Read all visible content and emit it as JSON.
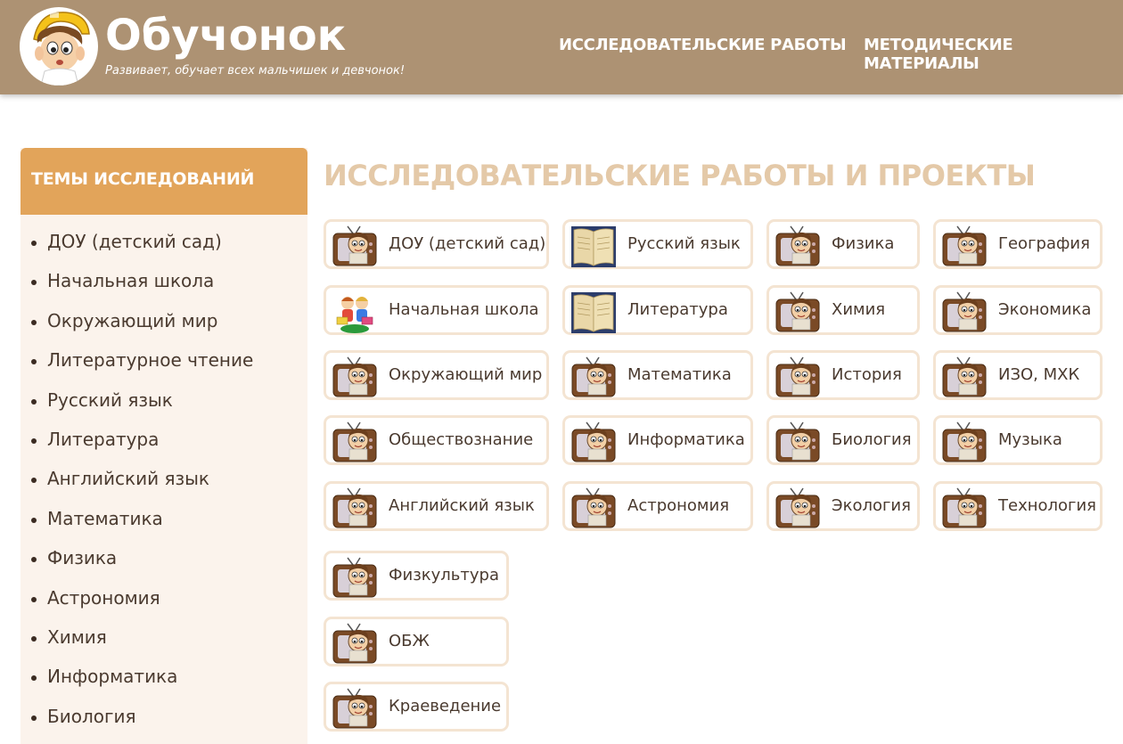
{
  "header": {
    "logo_title": "Обучонок",
    "logo_subtitle": "Развивает, обучает всех мальчишек и девчонок!",
    "nav": [
      "ИССЛЕДОВАТЕЛЬСКИЕ РАБОТЫ",
      "МЕТОДИЧЕСКИЕ МАТЕРИАЛЫ"
    ]
  },
  "sidebar": {
    "title": "ТЕМЫ ИССЛЕДОВАНИЙ",
    "items": [
      "ДОУ (детский сад)",
      "Начальная школа",
      "Окружающий мир",
      "Литературное чтение",
      "Русский язык",
      "Литература",
      "Английский язык",
      "Математика",
      "Физика",
      "Астрономия",
      "Химия",
      "Информатика",
      "Биология"
    ]
  },
  "main": {
    "title": "ИССЛЕДОВАТЕЛЬСКИЕ РАБОТЫ И ПРОЕКТЫ",
    "cards": [
      {
        "label": "ДОУ (детский сад)",
        "icon": "tv-mascot-icon"
      },
      {
        "label": "Русский язык",
        "icon": "book-icon"
      },
      {
        "label": "Физика",
        "icon": "tv-mascot-icon"
      },
      {
        "label": "География",
        "icon": "tv-mascot-icon"
      },
      {
        "label": "Начальная школа",
        "icon": "kids-icon"
      },
      {
        "label": "Литература",
        "icon": "book-icon"
      },
      {
        "label": "Химия",
        "icon": "tv-mascot-icon"
      },
      {
        "label": "Экономика",
        "icon": "tv-mascot-icon"
      },
      {
        "label": "Окружающий мир",
        "icon": "tv-mascot-icon"
      },
      {
        "label": "Математика",
        "icon": "tv-mascot-icon"
      },
      {
        "label": "История",
        "icon": "tv-mascot-icon"
      },
      {
        "label": "ИЗО, МХК",
        "icon": "tv-mascot-icon"
      },
      {
        "label": "Обществознание",
        "icon": "tv-mascot-icon"
      },
      {
        "label": "Информатика",
        "icon": "tv-mascot-icon"
      },
      {
        "label": "Биология",
        "icon": "tv-mascot-icon"
      },
      {
        "label": "Музыка",
        "icon": "tv-mascot-icon"
      },
      {
        "label": "Английский язык",
        "icon": "tv-mascot-icon"
      },
      {
        "label": "Астрономия",
        "icon": "tv-mascot-icon"
      },
      {
        "label": "Экология",
        "icon": "tv-mascot-icon"
      },
      {
        "label": "Технология",
        "icon": "tv-mascot-icon"
      },
      {
        "label": "Физкультура",
        "icon": "tv-mascot-icon"
      },
      {
        "label": "ОБЖ",
        "icon": "tv-mascot-icon"
      },
      {
        "label": "Краеведение",
        "icon": "tv-mascot-icon"
      }
    ]
  },
  "colors": {
    "header_bg": "#ad9273",
    "sidebar_head": "#e2a45a",
    "sidebar_bg": "#fbf3ec",
    "title_color": "#e4c9a8",
    "card_border": "#f4e4d2"
  }
}
